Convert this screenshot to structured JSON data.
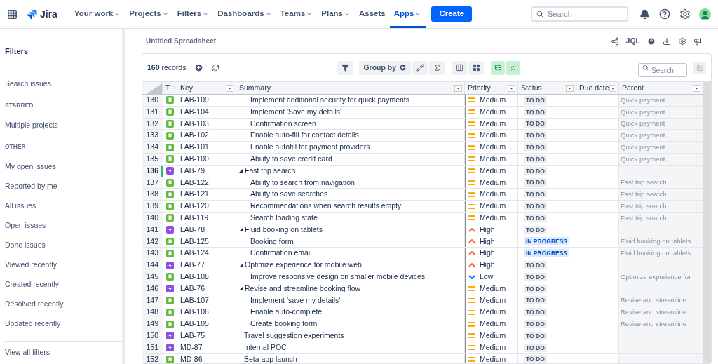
{
  "nav": {
    "product": "Jira",
    "items": [
      {
        "label": "Your work",
        "dropdown": true,
        "selected": false
      },
      {
        "label": "Projects",
        "dropdown": true,
        "selected": false
      },
      {
        "label": "Filters",
        "dropdown": true,
        "selected": false
      },
      {
        "label": "Dashboards",
        "dropdown": true,
        "selected": false
      },
      {
        "label": "Teams",
        "dropdown": true,
        "selected": false
      },
      {
        "label": "Plans",
        "dropdown": true,
        "selected": false
      },
      {
        "label": "Assets",
        "dropdown": false,
        "selected": false
      },
      {
        "label": "Apps",
        "dropdown": true,
        "selected": true
      }
    ],
    "create": "Create",
    "search": {
      "placeholder": "Search"
    }
  },
  "sidebar": {
    "title": "Filters",
    "sections": [
      {
        "items": [
          "Search issues"
        ]
      },
      {
        "heading": "STARRED",
        "items": [
          "Multiple projects"
        ]
      },
      {
        "heading": "OTHER",
        "items": [
          "My open issues",
          "Reported by me",
          "All issues",
          "Open issues",
          "Done issues",
          "Viewed recently",
          "Created recently",
          "Resolved recently",
          "Updated recently"
        ]
      }
    ],
    "footer": "View all filters"
  },
  "sheet": {
    "title": "Untitled Spreadsheet",
    "jql": "JQL",
    "records": "**160** records",
    "group_by": "Group by",
    "search": {
      "placeholder": "Search"
    }
  },
  "table": {
    "columns": [
      "T",
      "Key",
      "Summary",
      "Priority",
      "Status",
      "Due date",
      "Parent"
    ],
    "rows": [
      {
        "children": [
          {
            "num": "130",
            "kind": "story",
            "key": "LAB-109",
            "summary": "Implement additional security for quick payments",
            "priority": {
              "kind": "medium",
              "label": "Medium"
            },
            "status": {
              "kind": "todo",
              "label": "TO DO"
            },
            "parent": "Quick payment",
            "selected": false
          },
          {
            "num": "131",
            "kind": "story",
            "key": "LAB-104",
            "summary": "Implement 'Save my details'",
            "priority": {
              "kind": "medium",
              "label": "Medium"
            },
            "status": {
              "kind": "todo",
              "label": "TO DO"
            },
            "parent": "Quick payment",
            "selected": false
          },
          {
            "num": "132",
            "kind": "story",
            "key": "LAB-103",
            "summary": "Confirmation screen",
            "priority": {
              "kind": "medium",
              "label": "Medium"
            },
            "status": {
              "kind": "todo",
              "label": "TO DO"
            },
            "parent": "Quick payment",
            "selected": false
          },
          {
            "num": "133",
            "kind": "story",
            "key": "LAB-102",
            "summary": "Enable auto-fill for contact details",
            "priority": {
              "kind": "medium",
              "label": "Medium"
            },
            "status": {
              "kind": "todo",
              "label": "TO DO"
            },
            "parent": "Quick payment",
            "selected": false
          },
          {
            "num": "134",
            "kind": "story",
            "key": "LAB-101",
            "summary": "Enable autofill for payment providers",
            "priority": {
              "kind": "medium",
              "label": "Medium"
            },
            "status": {
              "kind": "todo",
              "label": "TO DO"
            },
            "parent": "Quick payment",
            "selected": false
          },
          {
            "num": "135",
            "kind": "story",
            "key": "LAB-100",
            "summary": "Ability to save credit card",
            "priority": {
              "kind": "medium",
              "label": "Medium"
            },
            "status": {
              "kind": "todo",
              "label": "TO DO"
            },
            "parent": "Quick payment",
            "selected": false
          }
        ]
      },
      {
        "num": "136",
        "kind": "epic",
        "key": "LAB-79",
        "summary": "Fast trip search",
        "priority": {
          "kind": "medium",
          "label": "Medium"
        },
        "status": {
          "kind": "todo",
          "label": "TO DO"
        },
        "selected": true,
        "expanded": true,
        "children": [
          {
            "num": "137",
            "kind": "story",
            "key": "LAB-122",
            "summary": "Ability to search from navigation",
            "priority": {
              "kind": "medium",
              "label": "Medium"
            },
            "status": {
              "kind": "todo",
              "label": "TO DO"
            },
            "parent": "Fast trip search",
            "selected": false
          },
          {
            "num": "138",
            "kind": "story",
            "key": "LAB-121",
            "summary": "Ability to save searches",
            "priority": {
              "kind": "medium",
              "label": "Medium"
            },
            "status": {
              "kind": "todo",
              "label": "TO DO"
            },
            "parent": "Fast trip search",
            "selected": false
          },
          {
            "num": "139",
            "kind": "story",
            "key": "LAB-120",
            "summary": "Recommendations when search results empty",
            "priority": {
              "kind": "medium",
              "label": "Medium"
            },
            "status": {
              "kind": "todo",
              "label": "TO DO"
            },
            "parent": "Fast trip search",
            "selected": false
          },
          {
            "num": "140",
            "kind": "story",
            "key": "LAB-119",
            "summary": "Search loading state",
            "priority": {
              "kind": "medium",
              "label": "Medium"
            },
            "status": {
              "kind": "todo",
              "label": "TO DO"
            },
            "parent": "Fast trip search",
            "selected": false
          }
        ]
      },
      {
        "num": "141",
        "kind": "epic",
        "key": "LAB-78",
        "summary": "Fluid booking on tablets",
        "priority": {
          "kind": "high",
          "label": "High"
        },
        "status": {
          "kind": "todo",
          "label": "TO DO"
        },
        "selected": false,
        "expanded": true,
        "children": [
          {
            "num": "142",
            "kind": "story",
            "key": "LAB-125",
            "summary": "Booking form",
            "priority": {
              "kind": "high",
              "label": "High"
            },
            "status": {
              "kind": "inprogress",
              "label": "IN PROGRESS"
            },
            "parent": "Fluid booking on tablets",
            "selected": false
          },
          {
            "num": "143",
            "kind": "story",
            "key": "LAB-124",
            "summary": "Confirmation email",
            "priority": {
              "kind": "high",
              "label": "High"
            },
            "status": {
              "kind": "inprogress",
              "label": "IN PROGRESS"
            },
            "parent": "Fluid booking on tablets",
            "selected": false
          }
        ]
      },
      {
        "num": "144",
        "kind": "epic",
        "key": "LAB-77",
        "summary": "Optimize experience for mobile web",
        "priority": {
          "kind": "high",
          "label": "High"
        },
        "status": {
          "kind": "todo",
          "label": "TO DO"
        },
        "selected": false,
        "expanded": true,
        "children": [
          {
            "num": "145",
            "kind": "story",
            "key": "LAB-108",
            "summary": "Improve responsive design on smaller mobile devices",
            "priority": {
              "kind": "low",
              "label": "Low"
            },
            "status": {
              "kind": "todo",
              "label": "TO DO"
            },
            "parent": "Optimize experience for",
            "parent_more": "...",
            "selected": false
          }
        ]
      },
      {
        "num": "146",
        "kind": "epic",
        "key": "LAB-76",
        "summary": "Revise and streamline booking flow",
        "priority": {
          "kind": "medium",
          "label": "Medium"
        },
        "status": {
          "kind": "todo",
          "label": "TO DO"
        },
        "selected": false,
        "expanded": true,
        "children": [
          {
            "num": "147",
            "kind": "story",
            "key": "LAB-107",
            "summary": "Implement 'save my details'",
            "priority": {
              "kind": "medium",
              "label": "Medium"
            },
            "status": {
              "kind": "todo",
              "label": "TO DO"
            },
            "parent": "Revise and streamline",
            "parent_more": "...",
            "selected": false
          },
          {
            "num": "148",
            "kind": "story",
            "key": "LAB-106",
            "summary": "Enable auto-complete",
            "priority": {
              "kind": "medium",
              "label": "Medium"
            },
            "status": {
              "kind": "todo",
              "label": "TO DO"
            },
            "parent": "Revise and streamline",
            "parent_more": "...",
            "selected": false
          },
          {
            "num": "149",
            "kind": "story",
            "key": "LAB-105",
            "summary": "Create booking form",
            "priority": {
              "kind": "medium",
              "label": "Medium"
            },
            "status": {
              "kind": "todo",
              "label": "TO DO"
            },
            "parent": "Revise and streamline",
            "parent_more": "...",
            "selected": false
          }
        ]
      },
      {
        "num": "150",
        "kind": "epic",
        "key": "LAB-75",
        "summary": "Travel suggestion experiments",
        "priority": {
          "kind": "medium",
          "label": "Medium"
        },
        "status": {
          "kind": "todo",
          "label": "TO DO"
        },
        "selected": false
      },
      {
        "num": "151",
        "kind": "epic",
        "key": "MD-87",
        "summary": "Internal POC",
        "priority": {
          "kind": "medium",
          "label": "Medium"
        },
        "status": {
          "kind": "todo",
          "label": "TO DO"
        },
        "selected": false
      },
      {
        "num": "152",
        "kind": "story",
        "key": "MD-86",
        "summary": "Beta app launch",
        "priority": {
          "kind": "medium",
          "label": "Medium"
        },
        "status": {
          "kind": "todo",
          "label": "TO DO"
        },
        "selected": false
      }
    ]
  }
}
